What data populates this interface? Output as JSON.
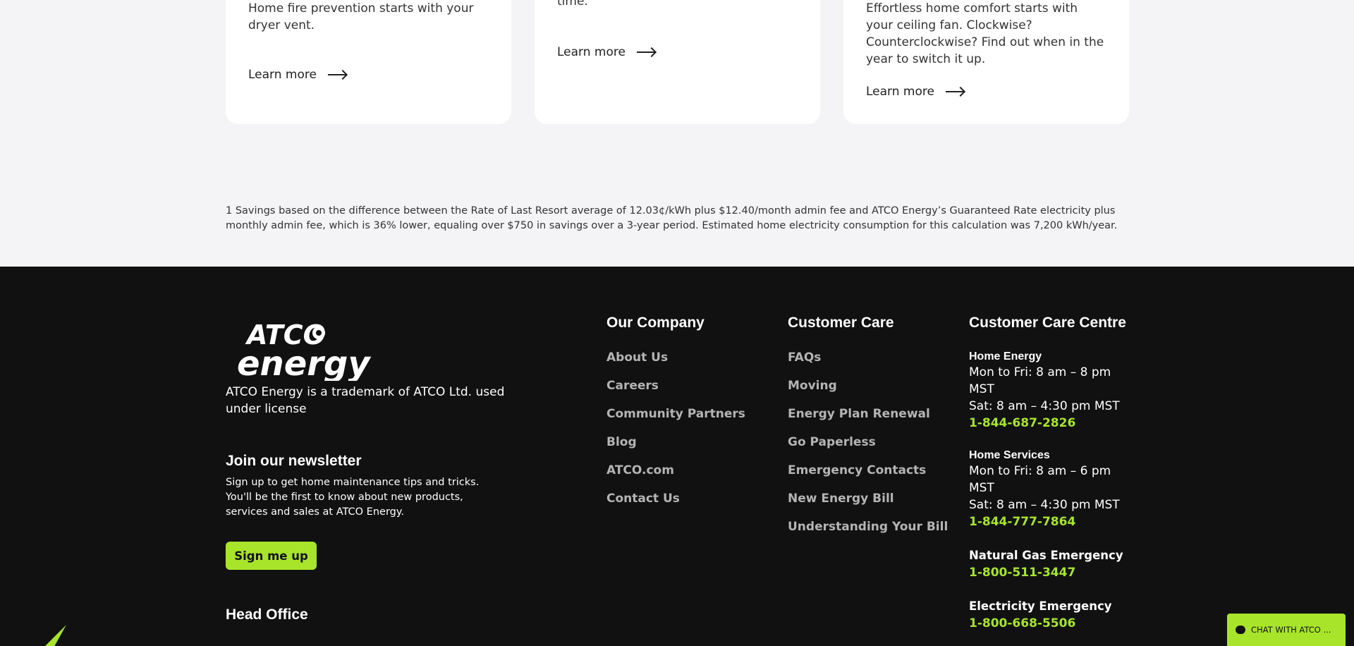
{
  "cards": [
    {
      "text": "Home fire prevention starts with your dryer vent.",
      "link": "Learn more"
    },
    {
      "text": "time.",
      "link": "Learn more"
    },
    {
      "text": "Effortless home comfort starts with your ceiling fan. Clockwise? Counterclockwise? Find out when in the year to switch it up.",
      "link": "Learn more"
    }
  ],
  "footnote": "1 Savings based on the difference between the Rate of Last Resort average of 12.03¢/kWh plus $12.40/month admin fee and ATCO Energy’s Guaranteed Rate electricity plus monthly admin fee, which is 36% lower, equaling over $750 in savings over a 3-year period. Estimated home electricity consumption for this calculation was 7,200 kWh/year.",
  "footer": {
    "logo_top": "ATCO",
    "logo_bottom": "energy",
    "trademark": "ATCO Energy is a trademark of ATCO Ltd. used under license",
    "newsletter_title": "Join our newsletter",
    "newsletter_text": "Sign up to get home maintenance tips and tricks. You'll be the first to know about new products, services and sales at ATCO Energy.",
    "signup_label": "Sign me up",
    "head_office": "Head Office",
    "company": {
      "title": "Our Company",
      "links": [
        "About Us",
        "Careers",
        "Community Partners",
        "Blog",
        "ATCO.com",
        "Contact Us"
      ]
    },
    "care": {
      "title": "Customer Care",
      "links": [
        "FAQs",
        "Moving",
        "Energy Plan Renewal",
        "Go Paperless",
        "Emergency Contacts",
        "New Energy Bill",
        "Understanding Your Bill"
      ]
    },
    "centre": {
      "title": "Customer Care Centre",
      "home_energy": {
        "label": "Home Energy",
        "hours1": "Mon to Fri: 8 am – 8 pm MST",
        "hours2": "Sat: 8 am – 4:30 pm MST",
        "phone": "1-844-687-2826"
      },
      "home_services": {
        "label": "Home Services",
        "hours1": "Mon to Fri: 8 am – 6 pm MST",
        "hours2": "Sat: 8 am – 4:30 pm MST",
        "phone": "1-844-777-7864"
      },
      "gas": {
        "label": "Natural Gas Emergency",
        "phone": "1-800-511-3447"
      },
      "electric": {
        "label": "Electricity Emergency",
        "phone": "1-800-668-5506"
      }
    }
  },
  "chat_label": "CHAT WITH ATCO ...",
  "colors": {
    "accent": "#a8e52a",
    "footer_bg": "#111111",
    "page_bg": "#f4f4f6"
  }
}
